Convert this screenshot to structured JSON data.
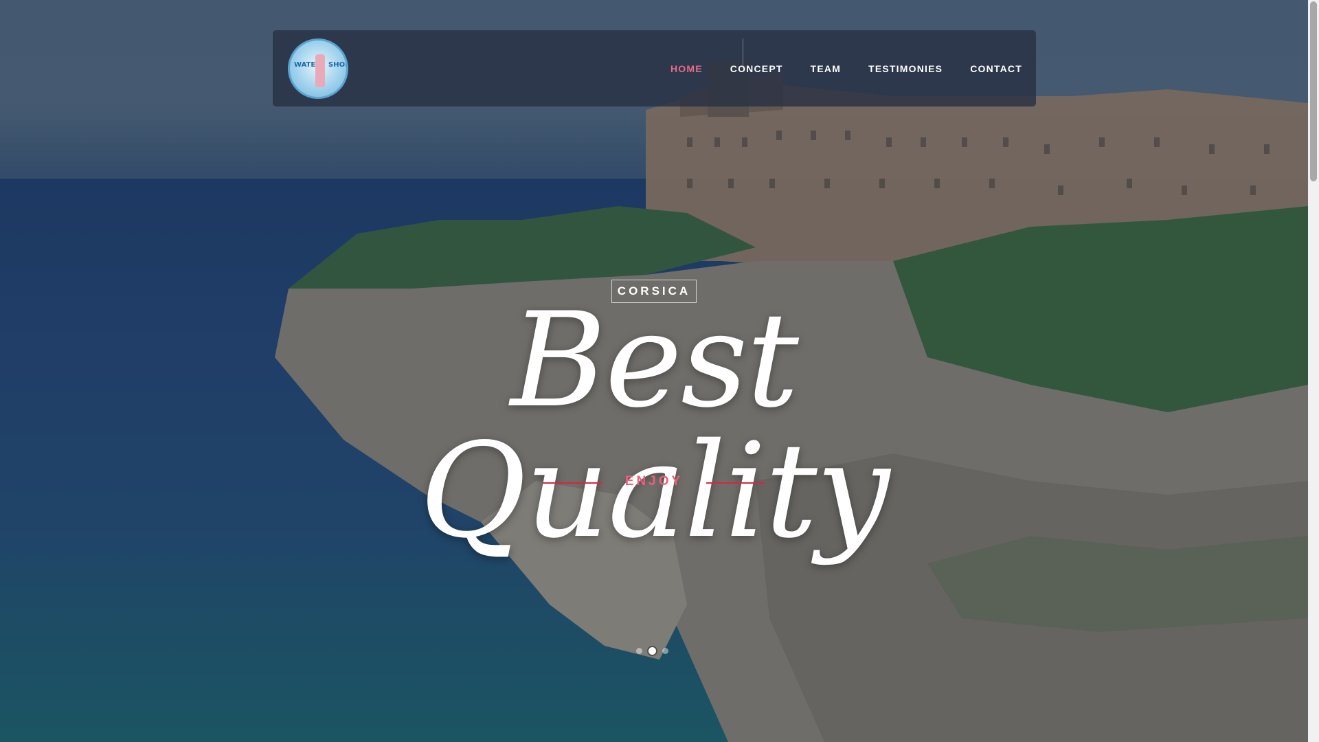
{
  "brand": {
    "logo_text_left": "WATER",
    "logo_text_right": "SHOP"
  },
  "nav": {
    "items": [
      {
        "label": "HOME",
        "active": true
      },
      {
        "label": "CONCEPT",
        "active": false
      },
      {
        "label": "TEAM",
        "active": false
      },
      {
        "label": "TESTIMONIES",
        "active": false
      },
      {
        "label": "CONTACT",
        "active": false
      }
    ]
  },
  "hero": {
    "badge": "CORSICA",
    "title": "Best Quality",
    "subtitle": "ENJOY",
    "slides_total": 3,
    "slide_active": 2
  },
  "colors": {
    "accent": "#ea6a86",
    "subtitle": "#ee5f79",
    "line": "#d7263d",
    "navbar_bg": "#263042"
  }
}
